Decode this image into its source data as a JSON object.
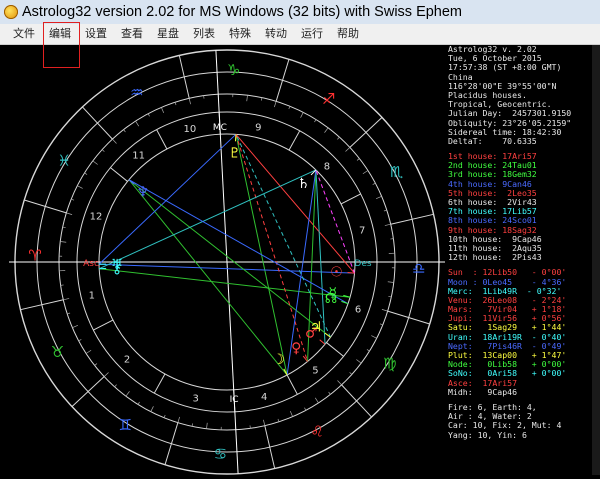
{
  "window": {
    "title": "Astrolog32 version 2.02 for MS Windows (32 bits) with Swiss Ephem"
  },
  "menu": {
    "items": [
      "文件",
      "编辑",
      "设置",
      "查看",
      "星盘",
      "列表",
      "特殊",
      "转动",
      "运行",
      "帮助"
    ]
  },
  "chart": {
    "sign_glyphs": [
      "♈",
      "♉",
      "♊",
      "♋",
      "♌",
      "♍",
      "♎",
      "♏",
      "♐",
      "♑",
      "♒",
      "♓"
    ],
    "sign_colors": [
      "#ff3030",
      "#30c030",
      "#3a6aff",
      "#30c0c0",
      "#ff3030",
      "#30c030",
      "#3a6aff",
      "#30c0c0",
      "#ff3030",
      "#30c030",
      "#3a6aff",
      "#30c0c0"
    ],
    "ascendant_longitude": 17,
    "house_cusps": [
      17,
      44,
      78,
      110,
      135,
      158,
      197,
      224,
      258,
      290,
      315,
      338
    ],
    "house_numbers": [
      "1",
      "2",
      "3",
      "4",
      "5",
      "6",
      "7",
      "8",
      "9",
      "10",
      "11",
      "12"
    ],
    "angle_labels": {
      "asc": "Asc",
      "des": "Des",
      "mc": "MC",
      "ic": "IC"
    },
    "planets": [
      {
        "glyph": "☉",
        "name": "Sun",
        "lon": 192,
        "color": "#ff4040"
      },
      {
        "glyph": "☽",
        "name": "Moon",
        "lon": 135,
        "color": "#ffff40"
      },
      {
        "glyph": "☿",
        "name": "Mercury",
        "lon": 181,
        "color": "#40ff40"
      },
      {
        "glyph": "♀",
        "name": "Venus",
        "lon": 146,
        "color": "#ff4040"
      },
      {
        "glyph": "♂",
        "name": "Mars",
        "lon": 157,
        "color": "#ff4040"
      },
      {
        "glyph": "♃",
        "name": "Jupiter",
        "lon": 161,
        "color": "#ffff40"
      },
      {
        "glyph": "♄",
        "name": "Saturn",
        "lon": 243,
        "color": "#ffffff"
      },
      {
        "glyph": "♅",
        "name": "Uranus",
        "lon": 18,
        "color": "#40ffff"
      },
      {
        "glyph": "♆",
        "name": "Neptune",
        "lon": 337,
        "color": "#4a6aff"
      },
      {
        "glyph": "♇",
        "name": "Pluto",
        "lon": 283,
        "color": "#ffff40"
      },
      {
        "glyph": "☊",
        "name": "Node",
        "lon": 178,
        "color": "#40ff40"
      },
      {
        "glyph": "⚷",
        "name": "Chiron",
        "lon": 20,
        "color": "#40ffff"
      }
    ],
    "aspect_lines": [
      {
        "a": 192,
        "b": 283,
        "color": "#ff4040",
        "dash": false
      },
      {
        "a": 135,
        "b": 283,
        "color": "#30c030",
        "dash": false
      },
      {
        "a": 135,
        "b": 337,
        "color": "#30c030",
        "dash": false
      },
      {
        "a": 18,
        "b": 283,
        "color": "#3a6aff",
        "dash": false
      },
      {
        "a": 18,
        "b": 192,
        "color": "#3a6aff",
        "dash": false
      },
      {
        "a": 243,
        "b": 157,
        "color": "#30c0c0",
        "dash": false
      },
      {
        "a": 243,
        "b": 146,
        "color": "#30c030",
        "dash": false
      },
      {
        "a": 337,
        "b": 161,
        "color": "#30c030",
        "dash": false
      },
      {
        "a": 20,
        "b": 181,
        "color": "#30c030",
        "dash": false
      },
      {
        "a": 283,
        "b": 146,
        "color": "#ff4040",
        "dash": true
      },
      {
        "a": 243,
        "b": 20,
        "color": "#30c0c0",
        "dash": false
      },
      {
        "a": 135,
        "b": 243,
        "color": "#3a6aff",
        "dash": false
      },
      {
        "a": 337,
        "b": 178,
        "color": "#3a6aff",
        "dash": false
      },
      {
        "a": 161,
        "b": 283,
        "color": "#30c0c0",
        "dash": true
      },
      {
        "a": 192,
        "b": 243,
        "color": "#ff40ff",
        "dash": true
      }
    ]
  },
  "info": {
    "header": [
      "Astrolog32 v. 2.02",
      "Tue, 6 October 2015",
      "17:57:38 (ST +8:00 GMT)",
      "China",
      "116°28'00\"E 39°55'00\"N",
      "Placidus houses.",
      "Tropical, Geocentric.",
      "Julian Day:  2457301.9150",
      "Obliquity: 23°26'05.2159\"",
      "Sidereal time: 18:42:30",
      "DeltaT:    70.6335"
    ],
    "houses": [
      {
        "text": "1st house: 17Ari57",
        "color": "#ff4040"
      },
      {
        "text": "2nd house: 24Tau01",
        "color": "#40ff40"
      },
      {
        "text": "3rd house: 18Gem32",
        "color": "#40ff40"
      },
      {
        "text": "4th house: 9Can46",
        "color": "#4a6aff"
      },
      {
        "text": "5th house:  2Leo35",
        "color": "#ff4040"
      },
      {
        "text": "6th house:  2Vir43",
        "color": "#e8e8e8"
      },
      {
        "text": "7th house: 17Lib57",
        "color": "#40ffff"
      },
      {
        "text": "8th house: 24Sco01",
        "color": "#4a6aff"
      },
      {
        "text": "9th house: 18Sag32",
        "color": "#ff4040"
      },
      {
        "text": "10th house:  9Cap46",
        "color": "#e8e8e8"
      },
      {
        "text": "11th house:  2Aqu35",
        "color": "#e8e8e8"
      },
      {
        "text": "12th house:  2Pis43",
        "color": "#e8e8e8"
      }
    ],
    "planets": [
      {
        "text": "Sun  : 12Lib50   - 0°00'",
        "color": "#ff4040"
      },
      {
        "text": "Moon : 0Leo45    - 4°36'",
        "color": "#4a6aff"
      },
      {
        "text": "Merc:  1Lib49R  - 0°32'",
        "color": "#40ffff"
      },
      {
        "text": "Venu:  26Leo08   - 2°24'",
        "color": "#ff4040"
      },
      {
        "text": "Mars:   7Vir04   + 1°18'",
        "color": "#ff4040"
      },
      {
        "text": "Jupi:  11Vir56   + 0°56'",
        "color": "#ff4040"
      },
      {
        "text": "Satu:   1Sag29   + 1°44'",
        "color": "#ffff40"
      },
      {
        "text": "Uran:  18Ari19R  - 0°40'",
        "color": "#40ffff"
      },
      {
        "text": "Nept:   7Pis46R  - 0°49'",
        "color": "#4a6aff"
      },
      {
        "text": "Plut:  13Cap00   + 1°47'",
        "color": "#ffff40"
      },
      {
        "text": "Node:   0Lib58   + 0°00'",
        "color": "#40ff40"
      },
      {
        "text": "SoNo:   0Ari58   + 0°00'",
        "color": "#40ffff"
      },
      {
        "text": "Asce:  17Ari57",
        "color": "#ff4040"
      },
      {
        "text": "Midh:   9Cap46",
        "color": "#e8e8e8"
      }
    ],
    "summary": [
      "Fire: 6, Earth: 4,",
      "Air : 4, Water: 2",
      "Car: 10, Fix: 2, Mut: 4",
      "Yang: 10, Yin: 6"
    ]
  }
}
